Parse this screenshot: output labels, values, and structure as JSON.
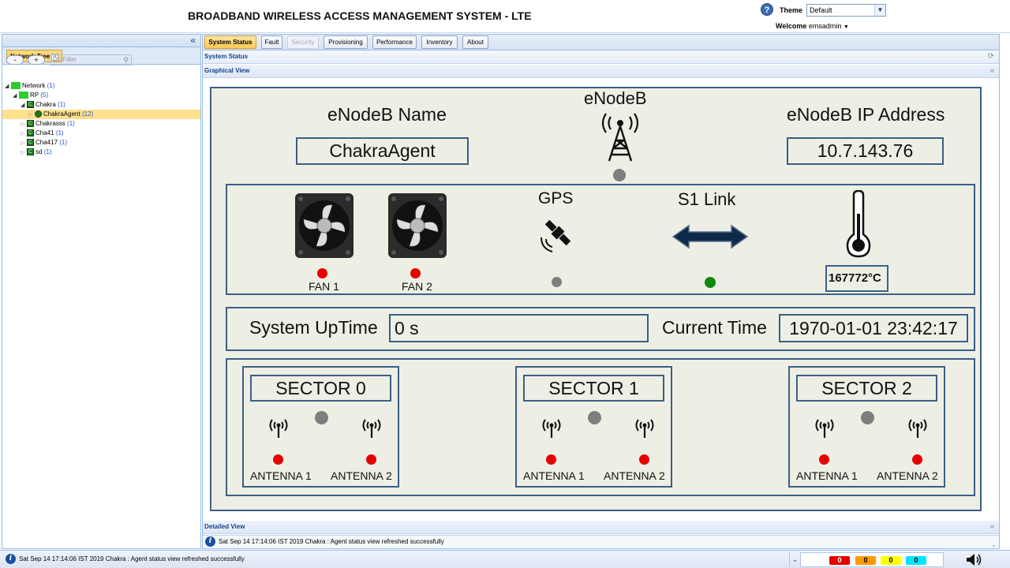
{
  "header": {
    "title": "BROADBAND WIRELESS ACCESS MANAGEMENT SYSTEM - LTE",
    "help_icon": "?",
    "theme_label": "Theme",
    "theme_value": "Default",
    "welcome_label": "Welcome",
    "user": "emsadmin"
  },
  "left": {
    "collapse_icon": "«",
    "tab_label": "Network Tree",
    "collapse_btn": "-",
    "expand_btn": "+",
    "filter_placeholder": "Do Filter",
    "tree": [
      {
        "label": "Network",
        "count": "(1)",
        "icon": "network-icon"
      },
      {
        "label": "RP",
        "count": "(5)",
        "icon": "network-icon"
      },
      {
        "label": "Chakra",
        "count": "(1)",
        "icon": "cluster-icon"
      },
      {
        "label": "ChakraAgent",
        "count": "(12)",
        "icon": "agent-icon",
        "selected": true
      },
      {
        "label": "Chakrasss",
        "count": "(1)",
        "icon": "cluster-icon"
      },
      {
        "label": "Cha41",
        "count": "(1)",
        "icon": "cluster-icon"
      },
      {
        "label": "Cha417",
        "count": "(1)",
        "icon": "cluster-icon"
      },
      {
        "label": "sd",
        "count": "(1)",
        "icon": "cluster-icon"
      }
    ]
  },
  "tabs": [
    {
      "label": "System Status",
      "state": "active"
    },
    {
      "label": "Fault",
      "state": "normal"
    },
    {
      "label": "Security",
      "state": "disabled"
    },
    {
      "label": "Provisioning",
      "state": "normal"
    },
    {
      "label": "Performance",
      "state": "normal"
    },
    {
      "label": "Inventory",
      "state": "normal"
    },
    {
      "label": "About",
      "state": "normal"
    }
  ],
  "sections": {
    "system_status": "System Status",
    "graphical_view": "Graphical View",
    "detailed_view": "Detailed View"
  },
  "enodeb": {
    "title": "eNodeB",
    "name_label": "eNodeB Name",
    "name_value": "ChakraAgent",
    "ip_label": "eNodeB IP Address",
    "ip_value": "10.7.143.76"
  },
  "hardware": {
    "fan1": "FAN 1",
    "fan2": "FAN 2",
    "gps": "GPS",
    "s1_link": "S1 Link",
    "temperature": "167772°C"
  },
  "uptime": {
    "label": "System UpTime",
    "value": "0 s",
    "time_label": "Current Time",
    "time_value": "1970-01-01 23:42:17"
  },
  "sectors": [
    {
      "name": "SECTOR 0",
      "ant1": "ANTENNA 1",
      "ant2": "ANTENNA 2"
    },
    {
      "name": "SECTOR 1",
      "ant1": "ANTENNA 1",
      "ant2": "ANTENNA 2"
    },
    {
      "name": "SECTOR 2",
      "ant1": "ANTENNA 1",
      "ant2": "ANTENNA 2"
    }
  ],
  "status_inner": "Sat Sep 14 17:14:06 IST 2019 Chakra : Agent status view refreshed successfully",
  "status_bar": "Sat Sep 14 17:14:06 IST 2019 Chakra : Agent status view refreshed successfully",
  "alarms": [
    {
      "count": "0",
      "color": "#e60000",
      "text_color": "#ffffff"
    },
    {
      "count": "0",
      "color": "#ff9900",
      "text_color": "#000000"
    },
    {
      "count": "0",
      "color": "#ffff00",
      "text_color": "#000000"
    },
    {
      "count": "0",
      "color": "#00e5ff",
      "text_color": "#000000"
    }
  ],
  "colors": {
    "accent": "#ffc94e",
    "frame": "#3b5f86",
    "panel": "#edefe4"
  }
}
